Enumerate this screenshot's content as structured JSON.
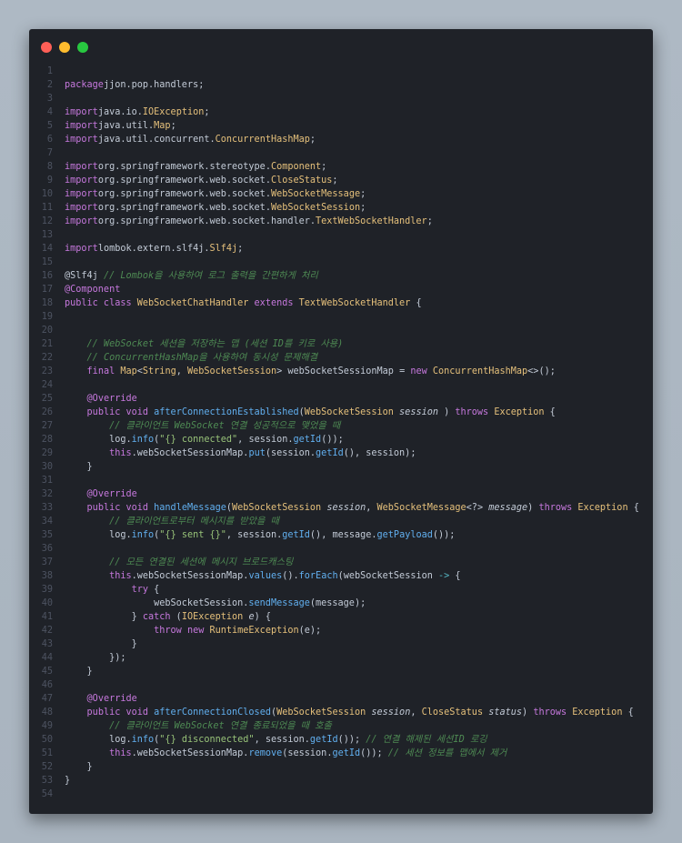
{
  "window": {
    "buttons": [
      "close",
      "minimize",
      "maximize"
    ]
  },
  "lines": [
    {
      "n": "1",
      "t": []
    },
    {
      "n": "2",
      "t": [
        [
          "kw",
          "package"
        ],
        [
          "",
          "jjon.pop.handlers;"
        ]
      ]
    },
    {
      "n": "3",
      "t": []
    },
    {
      "n": "4",
      "t": [
        [
          "kw",
          "import"
        ],
        [
          "",
          "java.io."
        ],
        [
          "ty",
          "IOException"
        ],
        [
          "",
          ";"
        ]
      ]
    },
    {
      "n": "5",
      "t": [
        [
          "kw",
          "import"
        ],
        [
          "",
          "java.util."
        ],
        [
          "ty",
          "Map"
        ],
        [
          "",
          ";"
        ]
      ]
    },
    {
      "n": "6",
      "t": [
        [
          "kw",
          "import"
        ],
        [
          "",
          "java.util.concurrent."
        ],
        [
          "ty",
          "ConcurrentHashMap"
        ],
        [
          "",
          ";"
        ]
      ]
    },
    {
      "n": "7",
      "t": []
    },
    {
      "n": "8",
      "t": [
        [
          "kw",
          "import"
        ],
        [
          "",
          "org.springframework.stereotype."
        ],
        [
          "ty",
          "Component"
        ],
        [
          "",
          ";"
        ]
      ]
    },
    {
      "n": "9",
      "t": [
        [
          "kw",
          "import"
        ],
        [
          "",
          "org.springframework.web.socket."
        ],
        [
          "ty",
          "CloseStatus"
        ],
        [
          "",
          ";"
        ]
      ]
    },
    {
      "n": "10",
      "t": [
        [
          "kw",
          "import"
        ],
        [
          "",
          "org.springframework.web.socket."
        ],
        [
          "ty",
          "WebSocketMessage"
        ],
        [
          "",
          ";"
        ]
      ]
    },
    {
      "n": "11",
      "t": [
        [
          "kw",
          "import"
        ],
        [
          "",
          "org.springframework.web.socket."
        ],
        [
          "ty",
          "WebSocketSession"
        ],
        [
          "",
          ";"
        ]
      ]
    },
    {
      "n": "12",
      "t": [
        [
          "kw",
          "import"
        ],
        [
          "",
          "org.springframework.web.socket.handler."
        ],
        [
          "ty",
          "TextWebSocketHandler"
        ],
        [
          "",
          ";"
        ]
      ]
    },
    {
      "n": "13",
      "t": []
    },
    {
      "n": "14",
      "t": [
        [
          "kw",
          "import"
        ],
        [
          "",
          "lombok.extern.slf4j."
        ],
        [
          "ty",
          "Slf4j"
        ],
        [
          "",
          ";"
        ]
      ]
    },
    {
      "n": "15",
      "t": []
    },
    {
      "n": "16",
      "t": [
        [
          "",
          "@Slf4j "
        ],
        [
          "cm",
          "// Lombok을 사용하여 로그 출력을 간편하게 처리"
        ]
      ]
    },
    {
      "n": "17",
      "t": [
        [
          "an",
          "@Component"
        ]
      ]
    },
    {
      "n": "18",
      "t": [
        [
          "kw",
          "public class "
        ],
        [
          "ty",
          "WebSocketChatHandler "
        ],
        [
          "kw",
          "extends "
        ],
        [
          "ty",
          "TextWebSocketHandler "
        ],
        [
          "",
          "{"
        ]
      ]
    },
    {
      "n": "19",
      "t": []
    },
    {
      "n": "20",
      "t": []
    },
    {
      "n": "21",
      "t": [
        [
          "",
          "    "
        ],
        [
          "cm",
          "// WebSocket 세션을 저장하는 맵 (세션 ID를 키로 사용)"
        ]
      ]
    },
    {
      "n": "22",
      "t": [
        [
          "",
          "    "
        ],
        [
          "cm",
          "// ConcurrentHashMap을 사용하여 동시성 문제해결"
        ]
      ]
    },
    {
      "n": "23",
      "t": [
        [
          "",
          "    "
        ],
        [
          "kw",
          "final "
        ],
        [
          "ty",
          "Map"
        ],
        [
          "",
          "<"
        ],
        [
          "ty",
          "String"
        ],
        [
          "",
          ", "
        ],
        [
          "ty",
          "WebSocketSession"
        ],
        [
          "",
          "> webSocketSessionMap = "
        ],
        [
          "kw",
          "new "
        ],
        [
          "ty",
          "ConcurrentHashMap"
        ],
        [
          "",
          "<>();"
        ]
      ]
    },
    {
      "n": "24",
      "t": []
    },
    {
      "n": "25",
      "t": [
        [
          "",
          "    "
        ],
        [
          "an",
          "@Override"
        ]
      ]
    },
    {
      "n": "26",
      "t": [
        [
          "",
          "    "
        ],
        [
          "kw",
          "public void "
        ],
        [
          "fn",
          "afterConnectionEstablished"
        ],
        [
          "",
          "("
        ],
        [
          "ty",
          "WebSocketSession "
        ],
        [
          "it",
          "session"
        ],
        [
          "",
          " ) "
        ],
        [
          "kw",
          "throws "
        ],
        [
          "ty",
          "Exception "
        ],
        [
          "",
          "{"
        ]
      ]
    },
    {
      "n": "27",
      "t": [
        [
          "",
          "        "
        ],
        [
          "cm",
          "// 클라이언트 WebSocket 연결 성공적으로 맺었을 때"
        ]
      ]
    },
    {
      "n": "28",
      "t": [
        [
          "",
          "        log."
        ],
        [
          "fn",
          "info"
        ],
        [
          "",
          "("
        ],
        [
          "str",
          "\"{} connected\""
        ],
        [
          "",
          ", session."
        ],
        [
          "fn",
          "getId"
        ],
        [
          "",
          "());"
        ]
      ]
    },
    {
      "n": "29",
      "t": [
        [
          "",
          "        "
        ],
        [
          "kw",
          "this"
        ],
        [
          "",
          ".webSocketSessionMap."
        ],
        [
          "fn",
          "put"
        ],
        [
          "",
          "(session."
        ],
        [
          "fn",
          "getId"
        ],
        [
          "",
          "(), session);"
        ]
      ]
    },
    {
      "n": "30",
      "t": [
        [
          "",
          "    }"
        ]
      ]
    },
    {
      "n": "31",
      "t": []
    },
    {
      "n": "32",
      "t": [
        [
          "",
          "    "
        ],
        [
          "an",
          "@Override"
        ]
      ]
    },
    {
      "n": "33",
      "t": [
        [
          "",
          "    "
        ],
        [
          "kw",
          "public void "
        ],
        [
          "fn",
          "handleMessage"
        ],
        [
          "",
          "("
        ],
        [
          "ty",
          "WebSocketSession "
        ],
        [
          "it",
          "session"
        ],
        [
          "",
          ", "
        ],
        [
          "ty",
          "WebSocketMessage"
        ],
        [
          "",
          "<?> "
        ],
        [
          "it",
          "message"
        ],
        [
          "",
          ") "
        ],
        [
          "kw",
          "throws "
        ],
        [
          "ty",
          "Exception "
        ],
        [
          "",
          "{"
        ]
      ]
    },
    {
      "n": "34",
      "t": [
        [
          "",
          "        "
        ],
        [
          "cm",
          "// 클라이언트로부터 메시지를 받았을 때"
        ]
      ]
    },
    {
      "n": "35",
      "t": [
        [
          "",
          "        log."
        ],
        [
          "fn",
          "info"
        ],
        [
          "",
          "("
        ],
        [
          "str",
          "\"{} sent {}\""
        ],
        [
          "",
          ", session."
        ],
        [
          "fn",
          "getId"
        ],
        [
          "",
          "(), message."
        ],
        [
          "fn",
          "getPayload"
        ],
        [
          "",
          "());"
        ]
      ]
    },
    {
      "n": "36",
      "t": []
    },
    {
      "n": "37",
      "t": [
        [
          "",
          "        "
        ],
        [
          "cm",
          "// 모든 연결된 세션에 메시지 브로드캐스팅"
        ]
      ]
    },
    {
      "n": "38",
      "t": [
        [
          "",
          "        "
        ],
        [
          "kw",
          "this"
        ],
        [
          "",
          ".webSocketSessionMap."
        ],
        [
          "fn",
          "values"
        ],
        [
          "",
          "()."
        ],
        [
          "fn",
          "forEach"
        ],
        [
          "",
          "(webSocketSession "
        ],
        [
          "op",
          "->"
        ],
        [
          "",
          " {"
        ]
      ]
    },
    {
      "n": "39",
      "t": [
        [
          "",
          "            "
        ],
        [
          "kw",
          "try"
        ],
        [
          "",
          " {"
        ]
      ]
    },
    {
      "n": "40",
      "t": [
        [
          "",
          "                webSocketSession."
        ],
        [
          "fn",
          "sendMessage"
        ],
        [
          "",
          "(message);"
        ]
      ]
    },
    {
      "n": "41",
      "t": [
        [
          "",
          "            } "
        ],
        [
          "kw",
          "catch"
        ],
        [
          "",
          " ("
        ],
        [
          "ty",
          "IOException "
        ],
        [
          "it",
          "e"
        ],
        [
          "",
          ") {"
        ]
      ]
    },
    {
      "n": "42",
      "t": [
        [
          "",
          "                "
        ],
        [
          "kw",
          "throw new "
        ],
        [
          "ty",
          "RuntimeException"
        ],
        [
          "",
          "(e);"
        ]
      ]
    },
    {
      "n": "43",
      "t": [
        [
          "",
          "            }"
        ]
      ]
    },
    {
      "n": "44",
      "t": [
        [
          "",
          "        });"
        ]
      ]
    },
    {
      "n": "45",
      "t": [
        [
          "",
          "    }"
        ]
      ]
    },
    {
      "n": "46",
      "t": []
    },
    {
      "n": "47",
      "t": [
        [
          "",
          "    "
        ],
        [
          "an",
          "@Override"
        ]
      ]
    },
    {
      "n": "48",
      "t": [
        [
          "",
          "    "
        ],
        [
          "kw",
          "public void "
        ],
        [
          "fn",
          "afterConnectionClosed"
        ],
        [
          "",
          "("
        ],
        [
          "ty",
          "WebSocketSession "
        ],
        [
          "it",
          "session"
        ],
        [
          "",
          ", "
        ],
        [
          "ty",
          "CloseStatus "
        ],
        [
          "it",
          "status"
        ],
        [
          "",
          ") "
        ],
        [
          "kw",
          "throws "
        ],
        [
          "ty",
          "Exception "
        ],
        [
          "",
          "{"
        ]
      ]
    },
    {
      "n": "49",
      "t": [
        [
          "",
          "        "
        ],
        [
          "cm",
          "// 클라이언트 WebSocket 연결 종료되었을 때 호출"
        ]
      ]
    },
    {
      "n": "50",
      "t": [
        [
          "",
          "        log."
        ],
        [
          "fn",
          "info"
        ],
        [
          "",
          "("
        ],
        [
          "str",
          "\"{} disconnected\""
        ],
        [
          "",
          ", session."
        ],
        [
          "fn",
          "getId"
        ],
        [
          "",
          "()); "
        ],
        [
          "cm",
          "// 연결 해제된 세션ID 로깅"
        ]
      ]
    },
    {
      "n": "51",
      "t": [
        [
          "",
          "        "
        ],
        [
          "kw",
          "this"
        ],
        [
          "",
          ".webSocketSessionMap."
        ],
        [
          "fn",
          "remove"
        ],
        [
          "",
          "(session."
        ],
        [
          "fn",
          "getId"
        ],
        [
          "",
          "()); "
        ],
        [
          "cm",
          "// 세션 정보를 맵에서 제거"
        ]
      ]
    },
    {
      "n": "52",
      "t": [
        [
          "",
          "    }"
        ]
      ]
    },
    {
      "n": "53",
      "t": [
        [
          "",
          "}"
        ]
      ]
    },
    {
      "n": "54",
      "t": []
    }
  ]
}
